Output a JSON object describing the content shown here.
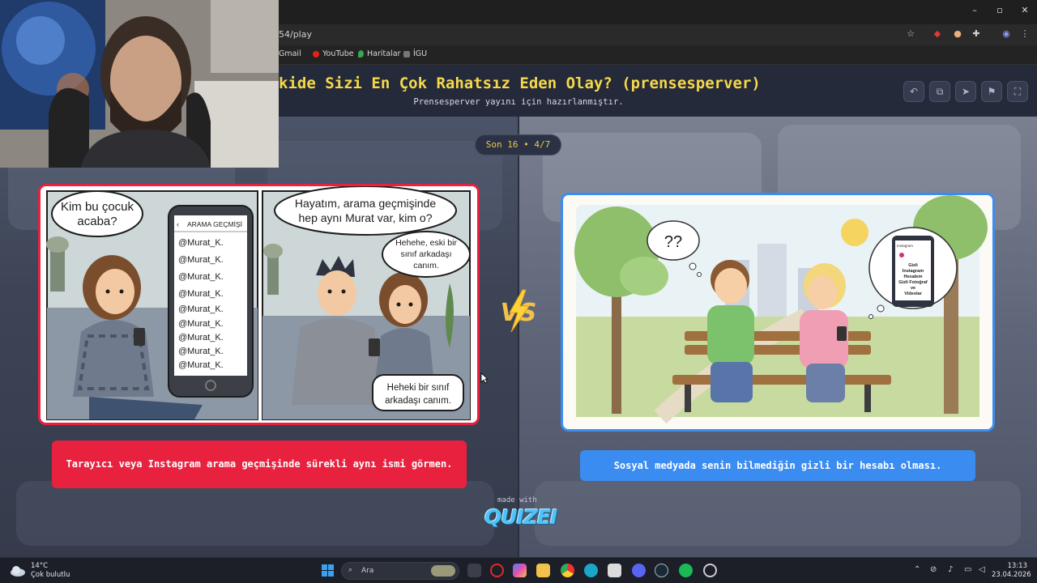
{
  "browser": {
    "url": "54/play",
    "bookmarks": [
      "Gmail",
      "YouTube",
      "Haritalar",
      "İGU"
    ]
  },
  "quiz": {
    "title": "kide Sizi En Çok Rahatsız Eden Olay? (prensesperver)",
    "subtitle": "Prensesperver yayını için hazırlanmıştır.",
    "counter": "Son 16 • 4/7",
    "vs_label": "VS",
    "made_with": "made with",
    "brand": "QUIZEI"
  },
  "left": {
    "option_text": "Tarayıcı veya Instagram arama geçmişinde sürekli aynı ismi görmen.",
    "comic": {
      "panel1_bubble": "Kim bu çocuk acaba?",
      "phone_header": "ARAMA GEÇMİŞİ",
      "history": [
        "@Murat_K.",
        "@Murat_K.",
        "@Murat_K.",
        "@Murat_K.",
        "@Murat_K.",
        "@Murat_K.",
        "@Murat_K.",
        "@Murat_K.",
        "@Murat_K."
      ],
      "panel2_bubble": "Hayatım, arama geçmişinde hep aynı Murat var, kim o?",
      "panel2_reply": "Hehehe, eski bir sınıf arkadaşı canım.",
      "panel2_caption": "Heheki bir sınıf arkadaşı canım."
    }
  },
  "right": {
    "option_text": "Sosyal medyada senin bilmediğin gizli bir hesabı olması.",
    "illustration": {
      "thought_left": "??",
      "phone_app": "Instagram",
      "phone_text": "Gizli Instagram Hesabım Gizli Fotoğraf ve Videolar"
    }
  },
  "taskbar": {
    "temp": "14°C",
    "weather": "Çok bulutlu",
    "search": "Ara",
    "time": "13:13",
    "date": "23.04.2026"
  },
  "colors": {
    "left_accent": "#e8213f",
    "right_accent": "#3b8cf0",
    "title": "#f5d94a"
  }
}
